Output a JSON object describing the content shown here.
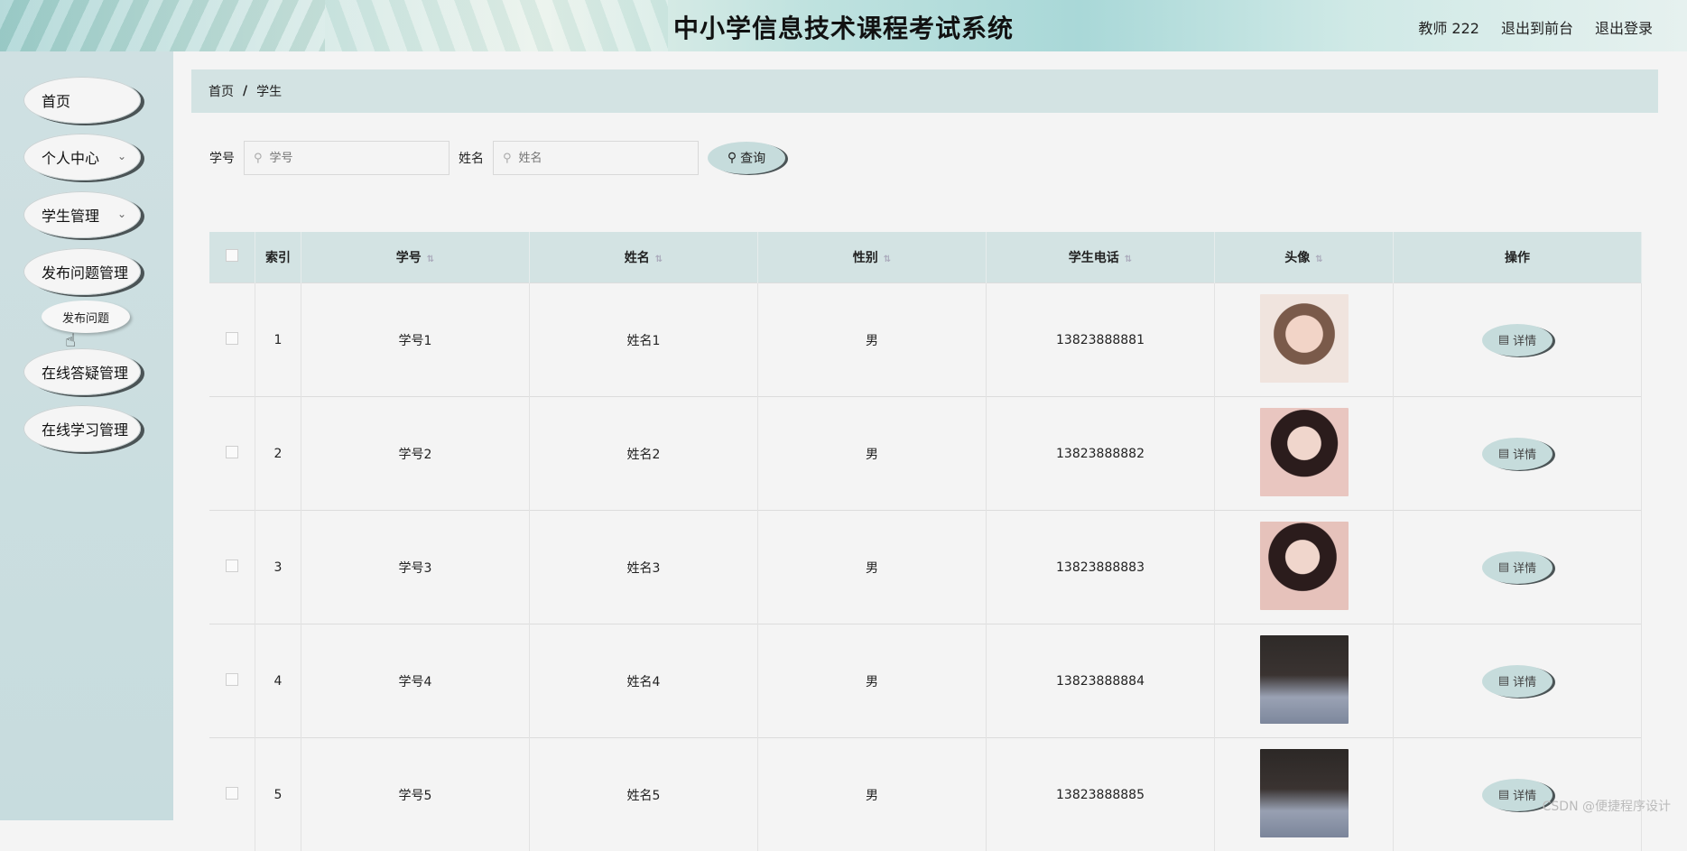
{
  "header": {
    "title": "中小学信息技术课程考试系统",
    "links": [
      "教师 222",
      "退出到前台",
      "退出登录"
    ]
  },
  "sidebar": {
    "items": [
      {
        "label": "首页"
      },
      {
        "label": "个人中心"
      },
      {
        "label": "学生管理"
      },
      {
        "label": "发布问题管理"
      },
      {
        "label": "在线答疑管理"
      },
      {
        "label": "在线学习管理"
      }
    ],
    "submenu_label": "发布问题"
  },
  "breadcrumb": {
    "home": "首页",
    "sep": "/",
    "current": "学生"
  },
  "search": {
    "id_label": "学号",
    "id_placeholder": "学号",
    "name_label": "姓名",
    "name_placeholder": "姓名",
    "query_label": "查询"
  },
  "table": {
    "headers": [
      "索引",
      "学号",
      "姓名",
      "性别",
      "学生电话",
      "头像",
      "操作"
    ],
    "detail_label": "详情",
    "rows": [
      {
        "index": "1",
        "student_id": "学号1",
        "name": "姓名1",
        "gender": "男",
        "phone": "13823888881"
      },
      {
        "index": "2",
        "student_id": "学号2",
        "name": "姓名2",
        "gender": "男",
        "phone": "13823888882"
      },
      {
        "index": "3",
        "student_id": "学号3",
        "name": "姓名3",
        "gender": "男",
        "phone": "13823888883"
      },
      {
        "index": "4",
        "student_id": "学号4",
        "name": "姓名4",
        "gender": "男",
        "phone": "13823888884"
      },
      {
        "index": "5",
        "student_id": "学号5",
        "name": "姓名5",
        "gender": "男",
        "phone": "13823888885"
      }
    ]
  },
  "watermark": "CSDN @便捷程序设计",
  "colors": {
    "accent": "#c6dcdc",
    "header_bg": "#d3e3e3",
    "shadow": "#4b5456"
  }
}
